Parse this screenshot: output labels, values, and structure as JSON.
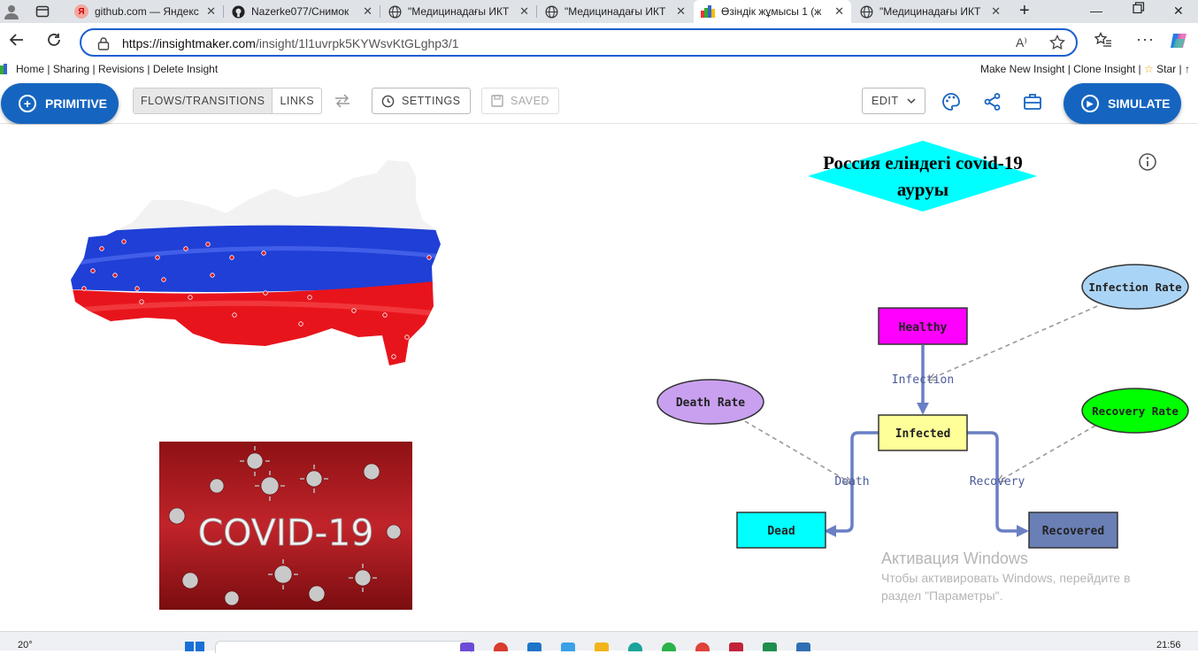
{
  "browser": {
    "tabs": [
      {
        "label": "github.com — Яндекс",
        "icon": "yandex-icon"
      },
      {
        "label": "Nazerke077/Снимок",
        "icon": "github-icon"
      },
      {
        "label": "\"Медицинадағы ИКТ",
        "icon": "globe-icon"
      },
      {
        "label": "\"Медицинадағы ИКТ",
        "icon": "globe-icon"
      },
      {
        "label": "Өзіндік жұмысы 1 (ж",
        "icon": "insightmaker-icon"
      },
      {
        "label": "\"Медицинадағы ИКТ",
        "icon": "globe-icon"
      }
    ],
    "url_host": "https://insightmaker.com",
    "url_path": "/insight/1l1uvrpk5KYWsvKtGLghp3/1",
    "reader_label": "A⁾"
  },
  "insight_nav": {
    "left": [
      "Home",
      "Sharing",
      "Revisions",
      "Delete Insight"
    ],
    "right": [
      "Make New Insight",
      "Clone Insight",
      "Star",
      "↑"
    ]
  },
  "toolbar": {
    "primitive_label": "PRIMITIVE",
    "flows_label": "FLOWS/TRANSITIONS",
    "links_label": "LINKS",
    "settings_label": "SETTINGS",
    "saved_label": "SAVED",
    "edit_label": "EDIT",
    "simulate_label": "SIMULATE"
  },
  "model": {
    "title_line1": "Россия еліндегі covid-19",
    "title_line2": "ауруы",
    "stocks": {
      "healthy": "Healthy",
      "infected": "Infected",
      "dead": "Dead",
      "recovered": "Recovered"
    },
    "variables": {
      "infection_rate": "Infection Rate",
      "death_rate": "Death Rate",
      "recovery_rate": "Recovery Rate"
    },
    "flows": {
      "infection": "Infection",
      "death": "Death",
      "recovery": "Recovery"
    },
    "images": {
      "covid_text": "COVID-19"
    },
    "colors": {
      "healthy": "#ff00ff",
      "infected": "#ffff99",
      "dead": "#00ffff",
      "recovered": "#6a7fb5",
      "infection_rate": "#aad4f5",
      "death_rate": "#c9a0f0",
      "recovery_rate": "#00ff00",
      "title_fill": "#00ffff",
      "flow": "#6a7fc4"
    }
  },
  "windows_watermark": {
    "line1": "Активация Windows",
    "line2": "Чтобы активировать Windows, перейдите в",
    "line3": "раздел \"Параметры\"."
  },
  "taskbar": {
    "temperature": "20°",
    "time": "21:56"
  }
}
